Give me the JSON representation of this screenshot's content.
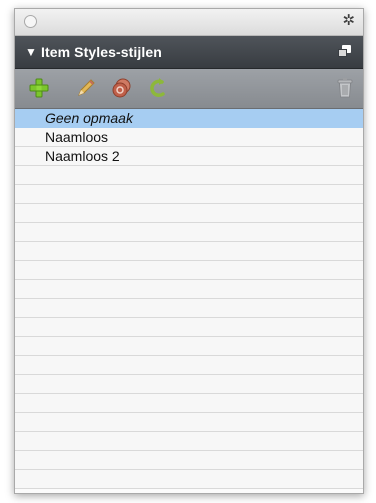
{
  "panel": {
    "window_icon": "gear-icon",
    "title": "Item Styles-stijlen",
    "collapse_glyph": "▼",
    "gear_glyph": "✲"
  },
  "toolbar": {
    "icons": [
      "add-icon",
      "edit-pencil-icon",
      "duplicate-icon",
      "refresh-icon",
      "trash-icon"
    ]
  },
  "styles": [
    {
      "label": "Geen opmaak",
      "selected": true
    },
    {
      "label": "Naamloos",
      "selected": false
    },
    {
      "label": "Naamloos 2",
      "selected": false
    }
  ],
  "colors": {
    "header": "#3f4348",
    "toolbar": "#92969b",
    "selection": "#a6cdf2",
    "add_icon": "#7cc62c",
    "edit_icon": "#d9b24f",
    "duplicate_icon": "#c0604a",
    "refresh_icon": "#8db83b"
  }
}
